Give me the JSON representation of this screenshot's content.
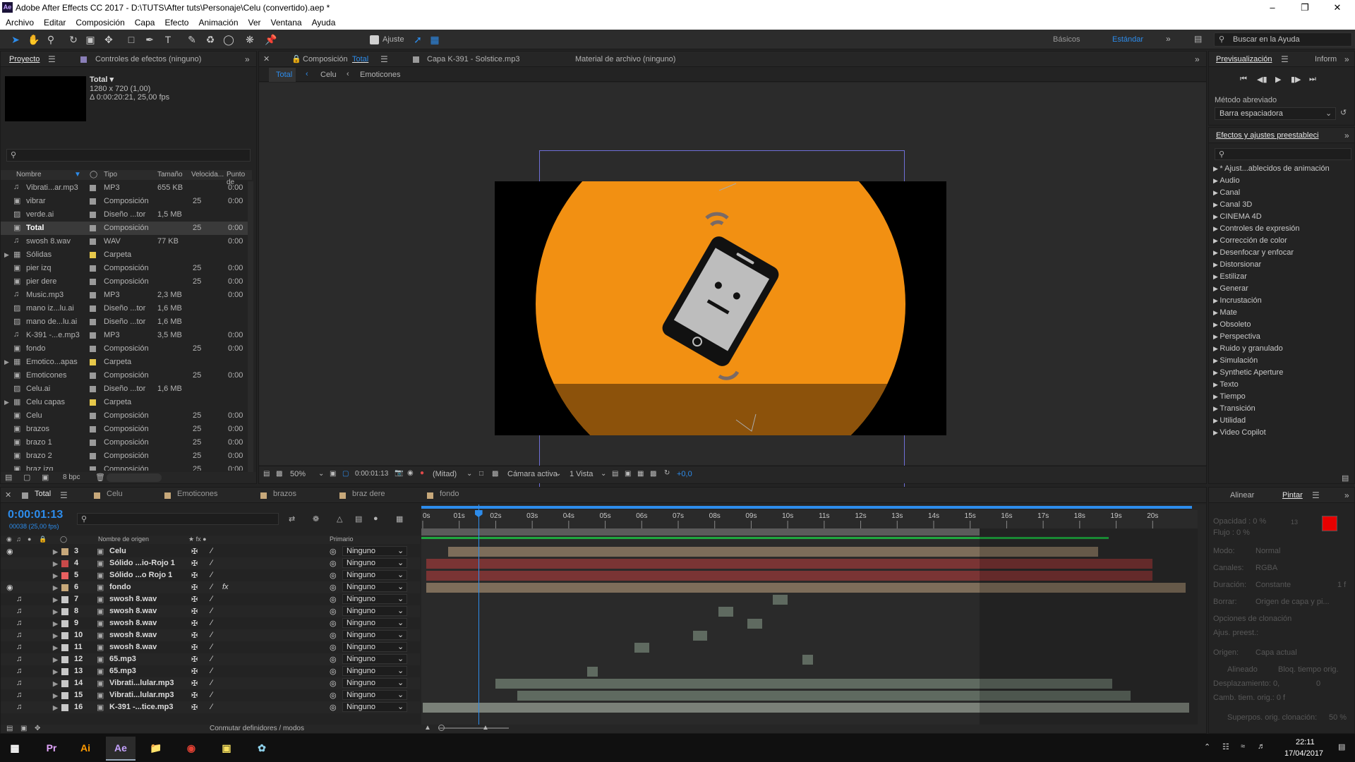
{
  "window": {
    "title": "Adobe After Effects CC 2017 - D:\\TUTS\\After tuts\\Personaje\\Celu (convertido).aep *",
    "app_icon": "Ae"
  },
  "menu": [
    "Archivo",
    "Editar",
    "Composición",
    "Capa",
    "Efecto",
    "Animación",
    "Ver",
    "Ventana",
    "Ayuda"
  ],
  "toolbar": {
    "snap_label": "Ajuste",
    "workspaces": [
      "Básicos",
      "Estándar"
    ],
    "search_placeholder": "Buscar en la Ayuda"
  },
  "project": {
    "tabs": [
      "Proyecto",
      "Controles de efectos  (ninguno)"
    ],
    "selected_name": "Total ▾",
    "selected_info1": "1280 x 720 (1,00)",
    "selected_info2": "Δ 0:00:20:21, 25,00 fps",
    "columns": [
      "Nombre",
      "Tipo",
      "Tamaño",
      "Velocida...",
      "Punto de"
    ],
    "items": [
      {
        "name": "Vibrati...ar.mp3",
        "type": "MP3",
        "size": "655 KB",
        "fps": "",
        "in": "0:00",
        "color": "#9a9a9a",
        "kind": "audio"
      },
      {
        "name": "vibrar",
        "type": "Composición",
        "size": "",
        "fps": "25",
        "in": "0:00",
        "color": "#9a9a9a",
        "kind": "comp"
      },
      {
        "name": "verde.ai",
        "type": "Diseño ...tor",
        "size": "1,5 MB",
        "fps": "",
        "in": "",
        "color": "#9a9a9a",
        "kind": "ai"
      },
      {
        "name": "Total",
        "type": "Composición",
        "size": "",
        "fps": "25",
        "in": "0:00",
        "color": "#9a9a9a",
        "kind": "comp"
      },
      {
        "name": "swosh 8.wav",
        "type": "WAV",
        "size": "77 KB",
        "fps": "",
        "in": "0:00",
        "color": "#9a9a9a",
        "kind": "audio"
      },
      {
        "name": "Sólidas",
        "type": "Carpeta",
        "size": "",
        "fps": "",
        "in": "",
        "color": "#e6c84a",
        "kind": "folder"
      },
      {
        "name": "pier izq",
        "type": "Composición",
        "size": "",
        "fps": "25",
        "in": "0:00",
        "color": "#9a9a9a",
        "kind": "comp"
      },
      {
        "name": "pier dere",
        "type": "Composición",
        "size": "",
        "fps": "25",
        "in": "0:00",
        "color": "#9a9a9a",
        "kind": "comp"
      },
      {
        "name": "Music.mp3",
        "type": "MP3",
        "size": "2,3 MB",
        "fps": "",
        "in": "0:00",
        "color": "#9a9a9a",
        "kind": "audio"
      },
      {
        "name": "mano iz...lu.ai",
        "type": "Diseño ...tor",
        "size": "1,6 MB",
        "fps": "",
        "in": "",
        "color": "#9a9a9a",
        "kind": "ai"
      },
      {
        "name": "mano de...lu.ai",
        "type": "Diseño ...tor",
        "size": "1,6 MB",
        "fps": "",
        "in": "",
        "color": "#9a9a9a",
        "kind": "ai"
      },
      {
        "name": "K-391 -...e.mp3",
        "type": "MP3",
        "size": "3,5 MB",
        "fps": "",
        "in": "0:00",
        "color": "#9a9a9a",
        "kind": "audio"
      },
      {
        "name": "fondo",
        "type": "Composición",
        "size": "",
        "fps": "25",
        "in": "0:00",
        "color": "#9a9a9a",
        "kind": "comp"
      },
      {
        "name": "Emotico...apas",
        "type": "Carpeta",
        "size": "",
        "fps": "",
        "in": "",
        "color": "#e6c84a",
        "kind": "folder"
      },
      {
        "name": "Emoticones",
        "type": "Composición",
        "size": "",
        "fps": "25",
        "in": "0:00",
        "color": "#9a9a9a",
        "kind": "comp"
      },
      {
        "name": "Celu.ai",
        "type": "Diseño ...tor",
        "size": "1,6 MB",
        "fps": "",
        "in": "",
        "color": "#9a9a9a",
        "kind": "ai"
      },
      {
        "name": "Celu capas",
        "type": "Carpeta",
        "size": "",
        "fps": "",
        "in": "",
        "color": "#e6c84a",
        "kind": "folder"
      },
      {
        "name": "Celu",
        "type": "Composición",
        "size": "",
        "fps": "25",
        "in": "0:00",
        "color": "#9a9a9a",
        "kind": "comp"
      },
      {
        "name": "brazos",
        "type": "Composición",
        "size": "",
        "fps": "25",
        "in": "0:00",
        "color": "#9a9a9a",
        "kind": "comp"
      },
      {
        "name": "brazo  1",
        "type": "Composición",
        "size": "",
        "fps": "25",
        "in": "0:00",
        "color": "#9a9a9a",
        "kind": "comp"
      },
      {
        "name": "brazo 2",
        "type": "Composición",
        "size": "",
        "fps": "25",
        "in": "0:00",
        "color": "#9a9a9a",
        "kind": "comp"
      },
      {
        "name": "braz izq",
        "type": "Composición",
        "size": "",
        "fps": "25",
        "in": "0:00",
        "color": "#9a9a9a",
        "kind": "comp"
      }
    ],
    "footer_bpc": "8 bpc"
  },
  "composition": {
    "tabs": [
      "Composición",
      "Total",
      "Capa  K-391 - Solstice.mp3",
      "Material de archivo  (ninguno)"
    ],
    "breadcrumbs": [
      "Total",
      "Celu",
      "Emoticones"
    ],
    "zoom": "50%",
    "timecode": "0:00:01:13",
    "resolution": "(Mitad)",
    "camera": "Cámara activa",
    "views": "1 Vista",
    "exposure": "+0,0"
  },
  "preview": {
    "tabs": [
      "Previsualización",
      "Inform"
    ],
    "method_label": "Método abreviado",
    "method_value": "Barra espaciadora"
  },
  "effects": {
    "title": "Efectos y ajustes preestableci",
    "items": [
      "* Ajust...ablecidos de animación",
      "Audio",
      "Canal",
      "Canal 3D",
      "CINEMA 4D",
      "Controles de expresión",
      "Corrección de color",
      "Desenfocar y enfocar",
      "Distorsionar",
      "Estilizar",
      "Generar",
      "Incrustación",
      "Mate",
      "Obsoleto",
      "Perspectiva",
      "Ruido y granulado",
      "Simulación",
      "Synthetic Aperture",
      "Texto",
      "Tiempo",
      "Transición",
      "Utilidad",
      "Video Copilot"
    ]
  },
  "paint": {
    "tabs": [
      "Alinear",
      "Pintar"
    ],
    "opacity": "Opacidad : 0 %",
    "flow": "Flujo : 0 %",
    "mode_label": "Modo:",
    "mode_value": "Normal",
    "channels_label": "Canales:",
    "channels_value": "RGBA",
    "duration_label": "Duración:",
    "duration_value": "Constante",
    "duration_frames": "1 f",
    "erase_label": "Borrar:",
    "erase_value": "Origen de capa y pi...",
    "clone_options": "Opciones de clonación",
    "preset_label": "Ajus. preest.:",
    "source_label": "Origen:",
    "source_value": "Capa actual",
    "aligned": "Alineado",
    "lock_time": "Bloq. tiempo orig.",
    "offset_label": "Desplazamiento: 0,",
    "offset_y": "0",
    "time_shift": "Camb. tiem. orig.: 0 f",
    "overlay": "Superpos. orig. clonación:",
    "overlay_pct": "50 %",
    "foreground": "#e60000",
    "background": "#ffffff",
    "brush_size": "13"
  },
  "timeline": {
    "tabs": [
      "Total",
      "Celu",
      "Emoticones",
      "brazos",
      "braz dere",
      "fondo"
    ],
    "tab_colors": [
      "#9a9a9a",
      "#c7a87a",
      "#c7a87a",
      "#c7a87a",
      "#c7a87a",
      "#c7a87a"
    ],
    "timecode": "0:00:01:13",
    "frame_info": "00038 (25,00 fps)",
    "ruler": [
      "0s",
      "01s",
      "02s",
      "03s",
      "04s",
      "05s",
      "06s",
      "07s",
      "08s",
      "09s",
      "10s",
      "11s",
      "12s",
      "13s",
      "14s",
      "15s",
      "16s",
      "17s",
      "18s",
      "19s",
      "20s"
    ],
    "playhead_seconds": 1.52,
    "work_area_end_seconds": 15.25,
    "col_source": "Nombre de origen",
    "col_parent": "Primario",
    "layers": [
      {
        "num": "3",
        "name": "Celu",
        "parent": "Ninguno",
        "label": "#c7a87a",
        "video": true,
        "audio": false,
        "fx": false,
        "color": "#7d6d5a",
        "start": 0.7,
        "end": 18.5
      },
      {
        "num": "4",
        "name": "Sólido ...io-Rojo 1",
        "parent": "Ninguno",
        "label": "#c84a4a",
        "video": false,
        "audio": false,
        "fx": false,
        "color": "#7a3434",
        "start": 0.1,
        "end": 20.0
      },
      {
        "num": "5",
        "name": "Sólido ...o Rojo 1",
        "parent": "Ninguno",
        "label": "#e86060",
        "video": false,
        "audio": false,
        "fx": false,
        "color": "#7a3434",
        "start": 0.1,
        "end": 20.0
      },
      {
        "num": "6",
        "name": "fondo",
        "parent": "Ninguno",
        "label": "#c7a87a",
        "video": true,
        "audio": false,
        "fx": true,
        "color": "#7d6d5a",
        "start": 0.1,
        "end": 20.9
      },
      {
        "num": "7",
        "name": "swosh 8.wav",
        "parent": "Ninguno",
        "label": "#c8c8c8",
        "video": false,
        "audio": true,
        "fx": false,
        "color": "#5f6a60",
        "start": 9.6,
        "end": 10.0
      },
      {
        "num": "8",
        "name": "swosh 8.wav",
        "parent": "Ninguno",
        "label": "#c8c8c8",
        "video": false,
        "audio": true,
        "fx": false,
        "color": "#5f6a60",
        "start": 8.1,
        "end": 8.5
      },
      {
        "num": "9",
        "name": "swosh 8.wav",
        "parent": "Ninguno",
        "label": "#c8c8c8",
        "video": false,
        "audio": true,
        "fx": false,
        "color": "#5f6a60",
        "start": 8.9,
        "end": 9.3
      },
      {
        "num": "10",
        "name": "swosh 8.wav",
        "parent": "Ninguno",
        "label": "#c8c8c8",
        "video": false,
        "audio": true,
        "fx": false,
        "color": "#5f6a60",
        "start": 7.4,
        "end": 7.8
      },
      {
        "num": "11",
        "name": "swosh 8.wav",
        "parent": "Ninguno",
        "label": "#c8c8c8",
        "video": false,
        "audio": true,
        "fx": false,
        "color": "#5f6a60",
        "start": 5.8,
        "end": 6.2
      },
      {
        "num": "12",
        "name": "65.mp3",
        "parent": "Ninguno",
        "label": "#c8c8c8",
        "video": false,
        "audio": true,
        "fx": false,
        "color": "#5f6a60",
        "start": 10.4,
        "end": 10.7
      },
      {
        "num": "13",
        "name": "65.mp3",
        "parent": "Ninguno",
        "label": "#c8c8c8",
        "video": false,
        "audio": true,
        "fx": false,
        "color": "#5f6a60",
        "start": 4.5,
        "end": 4.8
      },
      {
        "num": "14",
        "name": "Vibrati...lular.mp3",
        "parent": "Ninguno",
        "label": "#c8c8c8",
        "video": false,
        "audio": true,
        "fx": false,
        "color": "#5f6a60",
        "start": 2.0,
        "end": 18.9
      },
      {
        "num": "15",
        "name": "Vibrati...lular.mp3",
        "parent": "Ninguno",
        "label": "#c8c8c8",
        "video": false,
        "audio": true,
        "fx": false,
        "color": "#5f6a60",
        "start": 2.6,
        "end": 19.4
      },
      {
        "num": "16",
        "name": "K-391 -...tice.mp3",
        "parent": "Ninguno",
        "label": "#c8c8c8",
        "video": false,
        "audio": true,
        "fx": false,
        "color": "#7a8078",
        "start": 0.0,
        "end": 21.0
      }
    ],
    "footer_label": "Conmutar definidores / modos"
  },
  "taskbar": {
    "apps": [
      "Pr",
      "Ai",
      "Ae"
    ],
    "time": "22:11",
    "date": "17/04/2017"
  }
}
